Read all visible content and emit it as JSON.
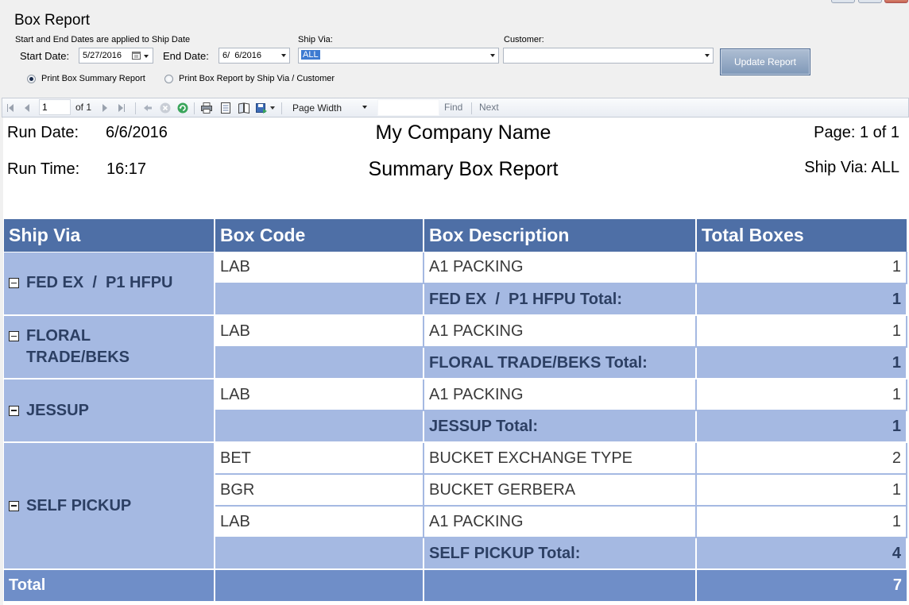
{
  "form": {
    "title": "Box Report",
    "date_note": "Start and End Dates are applied to Ship Date",
    "start_date_label": "Start Date:",
    "start_date_value": "5/27/2016",
    "end_date_label": "End Date:",
    "end_date_value": "6/  6/2016",
    "ship_via_label": "Ship Via:",
    "ship_via_value": "ALL",
    "customer_label": "Customer:",
    "customer_value": "",
    "radio_summary": "Print Box Summary Report",
    "radio_by_ship": "Print Box Report by Ship Via / Customer",
    "update_button": "Update Report"
  },
  "toolbar": {
    "page_current": "1",
    "page_of": "of 1",
    "zoom": "Page Width",
    "find_value": "",
    "find_label": "Find",
    "next_label": "Next"
  },
  "report": {
    "run_date_label": "Run Date:",
    "run_date": "6/6/2016",
    "run_time_label": "Run Time:",
    "run_time": "16:17",
    "company": "My Company Name",
    "report_title": "Summary Box Report",
    "page_info": "Page: 1 of 1",
    "ship_via_info": "Ship Via: ALL",
    "columns": [
      "Ship Via",
      "Box Code",
      "Box Description",
      "Total Boxes"
    ],
    "groups": [
      {
        "ship_via": "FED EX  /  P1 HFPU",
        "rows": [
          {
            "code": "LAB",
            "desc": "A1 PACKING",
            "total": "1"
          }
        ],
        "subtotal_label": "FED EX  /  P1 HFPU Total:",
        "subtotal": "1"
      },
      {
        "ship_via": "FLORAL TRADE/BEKS",
        "rows": [
          {
            "code": "LAB",
            "desc": "A1 PACKING",
            "total": "1"
          }
        ],
        "subtotal_label": "FLORAL TRADE/BEKS Total:",
        "subtotal": "1"
      },
      {
        "ship_via": "JESSUP",
        "rows": [
          {
            "code": "LAB",
            "desc": "A1 PACKING",
            "total": "1"
          }
        ],
        "subtotal_label": "JESSUP Total:",
        "subtotal": "1"
      },
      {
        "ship_via": "SELF PICKUP",
        "rows": [
          {
            "code": "BET",
            "desc": "BUCKET EXCHANGE TYPE",
            "total": "2"
          },
          {
            "code": "BGR",
            "desc": "BUCKET GERBERA",
            "total": "1"
          },
          {
            "code": "LAB",
            "desc": "A1 PACKING",
            "total": "1"
          }
        ],
        "subtotal_label": "SELF PICKUP Total:",
        "subtotal": "4"
      }
    ],
    "grand_total_label": "Total",
    "grand_total": "7"
  }
}
